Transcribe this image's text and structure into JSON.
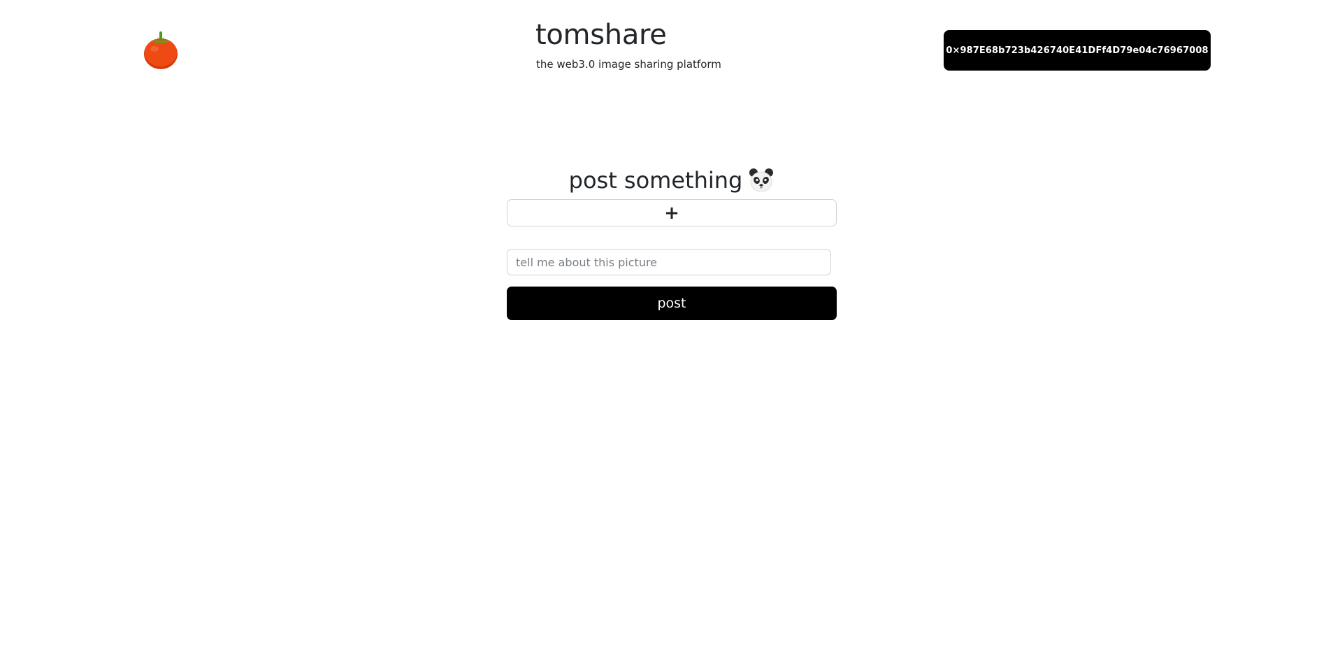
{
  "header": {
    "logo_icon": "tomato-icon",
    "title": "tomshare",
    "subtitle": "the web3.0 image sharing platform",
    "wallet_address": "0×987E68b723b426740E41DFf4D79e04c76967008"
  },
  "post_form": {
    "heading": "post something",
    "heading_icon": "panda-icon",
    "upload_icon": "plus-icon",
    "upload_symbol": "+",
    "caption_placeholder": "tell me about this picture",
    "caption_value": "",
    "submit_label": "post"
  },
  "colors": {
    "text": "#222529",
    "button_background": "#000000",
    "button_text": "#ffffff",
    "input_border": "#cfd2d6",
    "tomato_red": "#e8380f",
    "tomato_leaf": "#5aa321"
  }
}
